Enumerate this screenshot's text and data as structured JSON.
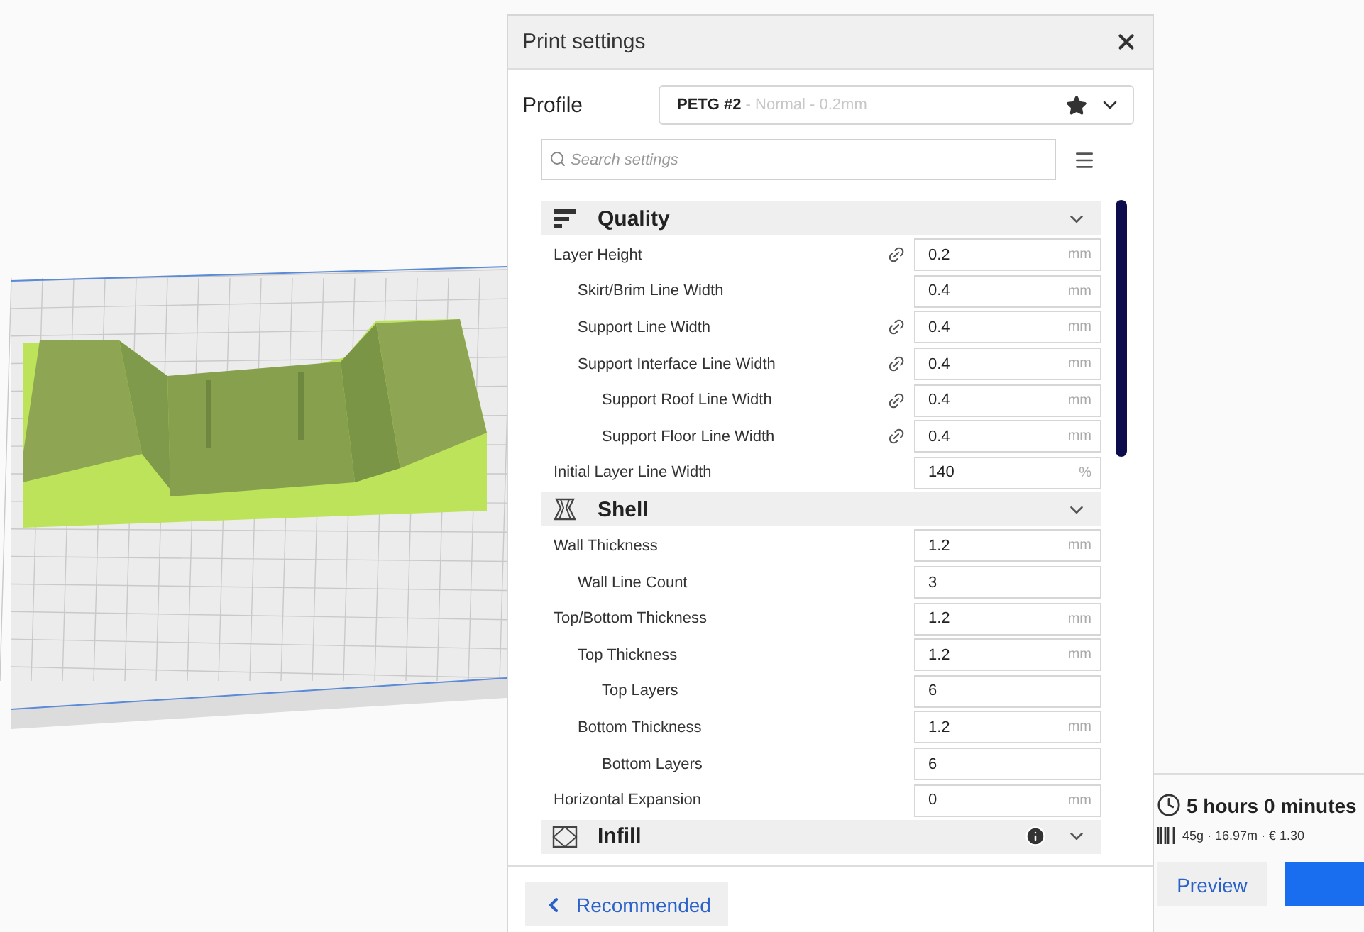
{
  "panel": {
    "title": "Print settings",
    "profile": {
      "label": "Profile",
      "name": "PETG #2",
      "detail": " - Normal - 0.2mm",
      "favorite": true
    },
    "search": {
      "placeholder": "Search settings"
    },
    "sections": [
      {
        "title": "Quality",
        "kind": "quality",
        "expanded": true,
        "info": false,
        "settings": [
          {
            "label": "Layer Height",
            "value": "0.2",
            "unit": "mm",
            "linked": true,
            "children": [
              {
                "label": "Skirt/Brim Line Width",
                "value": "0.4",
                "unit": "mm",
                "linked": false
              },
              {
                "label": "Support Line Width",
                "value": "0.4",
                "unit": "mm",
                "linked": true
              },
              {
                "label": "Support Interface Line Width",
                "value": "0.4",
                "unit": "mm",
                "linked": true,
                "children": [
                  {
                    "label": "Support Roof Line Width",
                    "value": "0.4",
                    "unit": "mm",
                    "linked": true
                  },
                  {
                    "label": "Support Floor Line Width",
                    "value": "0.4",
                    "unit": "mm",
                    "linked": true
                  }
                ]
              }
            ]
          },
          {
            "label": "Initial Layer Line Width",
            "value": "140",
            "unit": "%",
            "linked": false
          }
        ]
      },
      {
        "title": "Shell",
        "kind": "shell",
        "expanded": true,
        "info": false,
        "settings": [
          {
            "label": "Wall Thickness",
            "value": "1.2",
            "unit": "mm",
            "linked": false,
            "children": [
              {
                "label": "Wall Line Count",
                "value": "3",
                "linked": false
              }
            ]
          },
          {
            "label": "Top/Bottom Thickness",
            "value": "1.2",
            "unit": "mm",
            "linked": false,
            "children": [
              {
                "label": "Top Thickness",
                "value": "1.2",
                "unit": "mm",
                "linked": false,
                "children": [
                  {
                    "label": "Top Layers",
                    "value": "6",
                    "linked": false
                  }
                ]
              },
              {
                "label": "Bottom Thickness",
                "value": "1.2",
                "unit": "mm",
                "linked": false,
                "children": [
                  {
                    "label": "Bottom Layers",
                    "value": "6",
                    "linked": false
                  }
                ]
              }
            ]
          },
          {
            "label": "Horizontal Expansion",
            "value": "0",
            "unit": "mm",
            "linked": false
          }
        ]
      },
      {
        "title": "Infill",
        "kind": "infill",
        "expanded": true,
        "info": true
      }
    ],
    "recommended_button": "Recommended"
  },
  "estimate": {
    "time": "5 hours 0 minutes",
    "material": "45g · 16.97m · € 1.30",
    "preview_button": "Preview"
  }
}
